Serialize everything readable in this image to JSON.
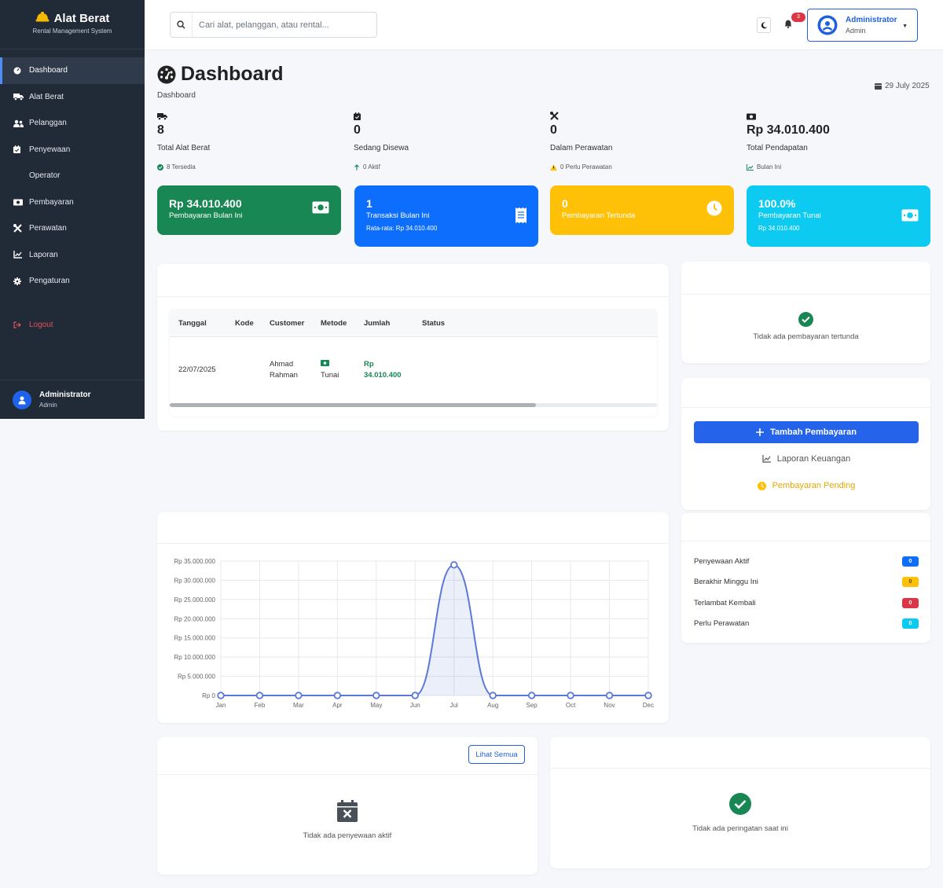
{
  "app": {
    "brand": "Alat Berat",
    "subtitle": "Rental Management System"
  },
  "sidebar": {
    "items": [
      {
        "label": "Dashboard",
        "icon": "dashboard-icon",
        "active": true
      },
      {
        "label": "Alat Berat",
        "icon": "truck-icon"
      },
      {
        "label": "Pelanggan",
        "icon": "users-icon"
      },
      {
        "label": "Penyewaan",
        "icon": "calendar-icon"
      },
      {
        "label": "Operator",
        "icon": ""
      },
      {
        "label": "Pembayaran",
        "icon": "money-icon"
      },
      {
        "label": "Perawatan",
        "icon": "tools-icon"
      },
      {
        "label": "Laporan",
        "icon": "chart-icon"
      },
      {
        "label": "Pengaturan",
        "icon": "gear-icon"
      }
    ],
    "logout": "Logout",
    "user": {
      "name": "Administrator",
      "role": "Admin"
    }
  },
  "topbar": {
    "search_placeholder": "Cari alat, pelanggan, atau rental...",
    "notif_count": "3",
    "user": {
      "name": "Administrator",
      "role": "Admin"
    }
  },
  "page": {
    "title": "Dashboard",
    "breadcrumb": "Dashboard",
    "date": "29 July 2025"
  },
  "stats": [
    {
      "value": "8",
      "label": "Total Alat Berat",
      "note": "8 Tersedia",
      "icon": "truck-icon"
    },
    {
      "value": "0",
      "label": "Sedang Disewa",
      "note": "0 Aktif",
      "icon": "calendar-icon"
    },
    {
      "value": "0",
      "label": "Dalam Perawatan",
      "note": "0 Perlu Perawatan",
      "icon": "tools-icon"
    },
    {
      "value": "Rp 34.010.400",
      "label": "Total Pendapatan",
      "note": "Bulan Ini",
      "icon": "money-icon"
    }
  ],
  "kpis": [
    {
      "value": "Rp 34.010.400",
      "label": "Pembayaran Bulan Ini",
      "sub": "",
      "color": "#198754"
    },
    {
      "value": "1",
      "label": "Transaksi Bulan Ini",
      "sub": "Rata-rata: Rp 34.010.400",
      "color": "#0d6efd"
    },
    {
      "value": "0",
      "label": "Pembayaran Tertunda",
      "sub": "",
      "color": "#ffc107"
    },
    {
      "value": "100.0%",
      "label": "Pembayaran Tunai",
      "sub": "Rp 34.010.400",
      "color": "#0dcaf0"
    }
  ],
  "payments_table": {
    "columns": [
      "Tanggal",
      "Kode",
      "Customer",
      "Metode",
      "Jumlah",
      "Status"
    ],
    "rows": [
      {
        "tanggal": "22/07/2025",
        "kode": "",
        "customer_1": "Ahmad",
        "customer_2": "Rahman",
        "metode": "Tunai",
        "jumlah_1": "Rp",
        "jumlah_2": "34.010.400",
        "status": ""
      }
    ]
  },
  "pending": {
    "empty": "Tidak ada pembayaran tertunda"
  },
  "quick_actions": {
    "primary": "Tambah Pembayaran",
    "report": "Laporan Keuangan",
    "pending": "Pembayaran Pending"
  },
  "status_list": [
    {
      "label": "Penyewaan Aktif",
      "count": "0",
      "color": "#0d6efd",
      "text": "#ffffff"
    },
    {
      "label": "Berakhir Minggu Ini",
      "count": "0",
      "color": "#ffc107",
      "text": "#5c4500"
    },
    {
      "label": "Terlambat Kembali",
      "count": "0",
      "color": "#dc3545",
      "text": "#ffffff"
    },
    {
      "label": "Perlu Perawatan",
      "count": "0",
      "color": "#0dcaf0",
      "text": "#ffffff"
    }
  ],
  "active_rentals": {
    "button": "Lihat Semua",
    "empty": "Tidak ada penyewaan aktif"
  },
  "warnings": {
    "empty": "Tidak ada peringatan saat ini"
  },
  "chart_data": {
    "type": "area",
    "categories": [
      "Jan",
      "Feb",
      "Mar",
      "Apr",
      "May",
      "Jun",
      "Jul",
      "Aug",
      "Sep",
      "Oct",
      "Nov",
      "Dec"
    ],
    "series": [
      {
        "values": [
          0,
          0,
          0,
          0,
          0,
          0,
          34010400,
          0,
          0,
          0,
          0,
          0
        ]
      }
    ],
    "y_ticks": [
      "Rp 0",
      "Rp 5.000.000",
      "Rp 10.000.000",
      "Rp 15.000.000",
      "Rp 20.000.000",
      "Rp 25.000.000",
      "Rp 30.000.000",
      "Rp 35.000.000"
    ],
    "ylim": [
      0,
      35000000
    ],
    "grid": true,
    "color": "#5b79d8"
  }
}
